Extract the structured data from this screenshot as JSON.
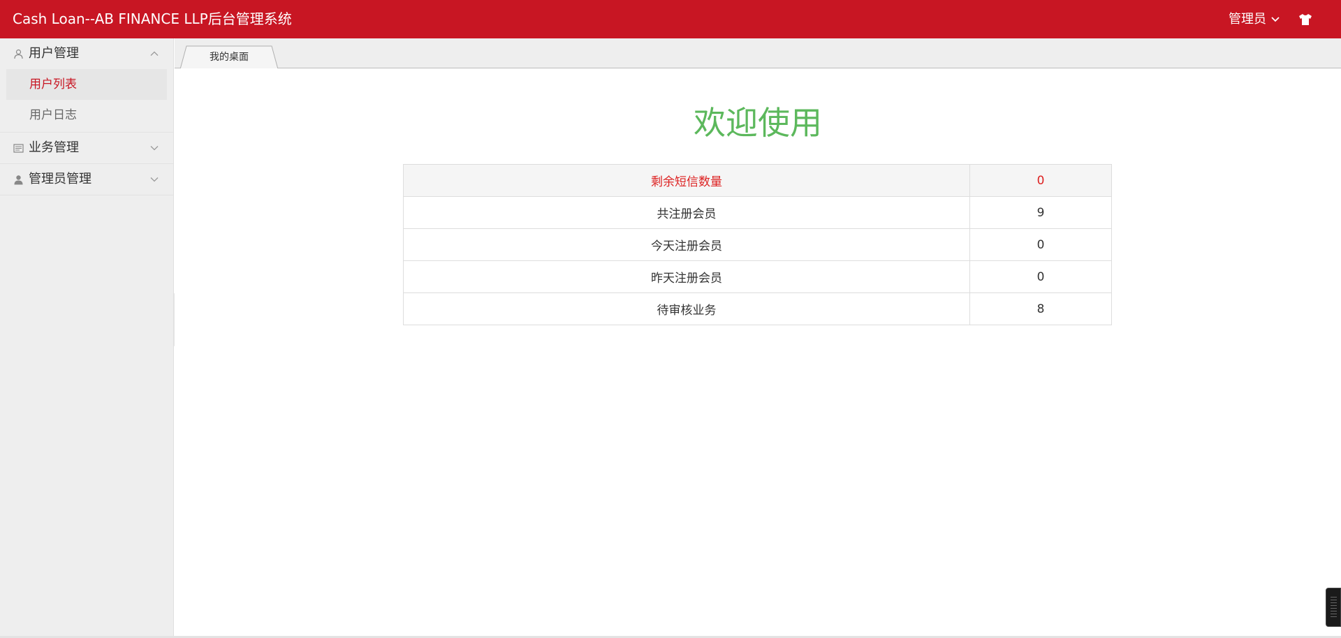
{
  "header": {
    "title": "Cash Loan--AB FINANCE LLP后台管理系统",
    "user_label": "管理员",
    "icons": [
      "chevron-down-icon",
      "tshirt-icon"
    ]
  },
  "sidebar": {
    "groups": [
      {
        "label": "用户管理",
        "icon": "user-outline-icon",
        "expanded": true,
        "items": [
          {
            "label": "用户列表",
            "active": true
          },
          {
            "label": "用户日志",
            "active": false
          }
        ]
      },
      {
        "label": "业务管理",
        "icon": "newspaper-icon",
        "expanded": false
      },
      {
        "label": "管理员管理",
        "icon": "user-solid-icon",
        "expanded": false
      }
    ]
  },
  "tabs": [
    {
      "label": "我的桌面",
      "active": true
    }
  ],
  "main": {
    "welcome": "欢迎使用",
    "stats": [
      {
        "label": "剩余短信数量",
        "value": "0",
        "highlight": true
      },
      {
        "label": "共注册会员",
        "value": "9"
      },
      {
        "label": "今天注册会员",
        "value": "0"
      },
      {
        "label": "昨天注册会员",
        "value": "0"
      },
      {
        "label": "待审核业务",
        "value": "8"
      }
    ]
  },
  "colors": {
    "brand": "#c81623",
    "welcome": "#5cb85c",
    "highlight_text": "#dd2222",
    "sidebar_bg": "#eeeeee"
  }
}
